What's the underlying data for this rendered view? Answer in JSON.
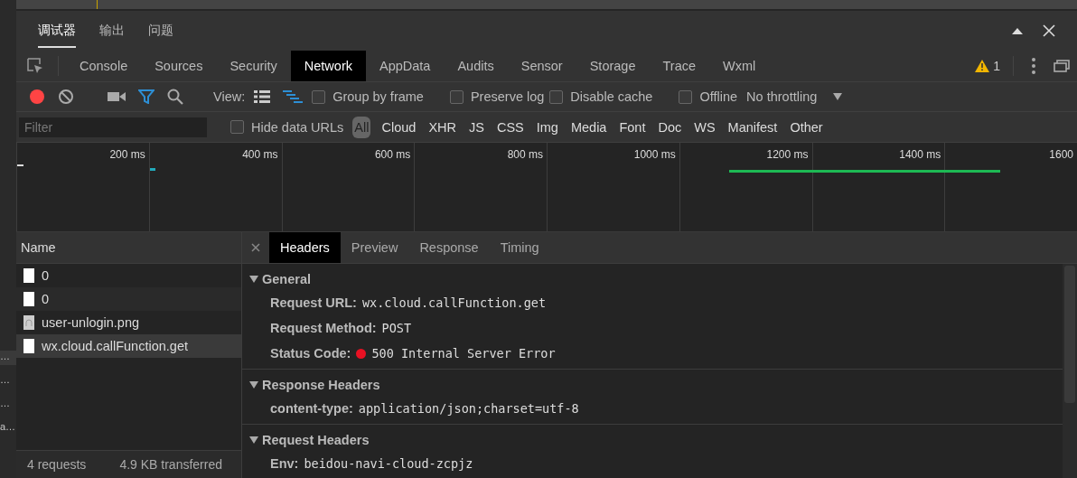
{
  "left_edge_items": [
    "…",
    "…",
    "…",
    "a…"
  ],
  "top_tabs": [
    {
      "label": "调试器",
      "selected": true
    },
    {
      "label": "输出",
      "selected": false
    },
    {
      "label": "问题",
      "selected": false
    }
  ],
  "panel_tabs": [
    {
      "label": "Console",
      "selected": false
    },
    {
      "label": "Sources",
      "selected": false
    },
    {
      "label": "Security",
      "selected": false
    },
    {
      "label": "Network",
      "selected": true
    },
    {
      "label": "AppData",
      "selected": false
    },
    {
      "label": "Audits",
      "selected": false
    },
    {
      "label": "Sensor",
      "selected": false
    },
    {
      "label": "Storage",
      "selected": false
    },
    {
      "label": "Trace",
      "selected": false
    },
    {
      "label": "Wxml",
      "selected": false
    }
  ],
  "warning_count": "1",
  "toolbar": {
    "recording": true,
    "filter_active": true,
    "view_label": "View:",
    "group_by_frame": {
      "label": "Group by frame",
      "checked": false
    },
    "preserve_log": {
      "label": "Preserve log",
      "checked": false
    },
    "disable_cache": {
      "label": "Disable cache",
      "checked": false
    },
    "offline": {
      "label": "Offline",
      "checked": false
    },
    "throttling": "No throttling"
  },
  "filter_bar": {
    "placeholder": "Filter",
    "hide_data_urls": {
      "label": "Hide data URLs",
      "checked": false
    },
    "types": [
      {
        "label": "All",
        "selected": true
      },
      {
        "label": "Cloud",
        "selected": false
      },
      {
        "label": "XHR",
        "selected": false
      },
      {
        "label": "JS",
        "selected": false
      },
      {
        "label": "CSS",
        "selected": false
      },
      {
        "label": "Img",
        "selected": false
      },
      {
        "label": "Media",
        "selected": false
      },
      {
        "label": "Font",
        "selected": false
      },
      {
        "label": "Doc",
        "selected": false
      },
      {
        "label": "WS",
        "selected": false
      },
      {
        "label": "Manifest",
        "selected": false
      },
      {
        "label": "Other",
        "selected": false
      }
    ]
  },
  "timeline": {
    "ticks": [
      "200 ms",
      "400 ms",
      "600 ms",
      "800 ms",
      "1000 ms",
      "1200 ms",
      "1400 ms",
      "1600"
    ]
  },
  "requests": {
    "column": "Name",
    "rows": [
      {
        "name": "0",
        "kind": "doc",
        "selected": false
      },
      {
        "name": "0",
        "kind": "doc",
        "selected": false
      },
      {
        "name": "user-unlogin.png",
        "kind": "image",
        "selected": false
      },
      {
        "name": "wx.cloud.callFunction.get",
        "kind": "doc",
        "selected": true
      }
    ],
    "summary": [
      "4 requests",
      "4.9 KB transferred"
    ]
  },
  "detail_tabs": [
    {
      "label": "Headers",
      "selected": true
    },
    {
      "label": "Preview",
      "selected": false
    },
    {
      "label": "Response",
      "selected": false
    },
    {
      "label": "Timing",
      "selected": false
    }
  ],
  "sections": [
    {
      "title": "General",
      "expanded": true,
      "rows": [
        {
          "key": "Request URL:",
          "value": "wx.cloud.callFunction.get"
        },
        {
          "key": "Request Method:",
          "value": "POST"
        },
        {
          "key": "Status Code:",
          "value": "500 Internal Server Error",
          "color": "#e81123"
        }
      ]
    },
    {
      "title": "Response Headers",
      "expanded": true,
      "rows": [
        {
          "key": "content-type:",
          "value": "application/json;charset=utf-8"
        }
      ]
    },
    {
      "title": "Request Headers",
      "expanded": true,
      "rows": [
        {
          "key": "Env:",
          "value": "beidou-navi-cloud-zcpjz"
        }
      ]
    }
  ]
}
